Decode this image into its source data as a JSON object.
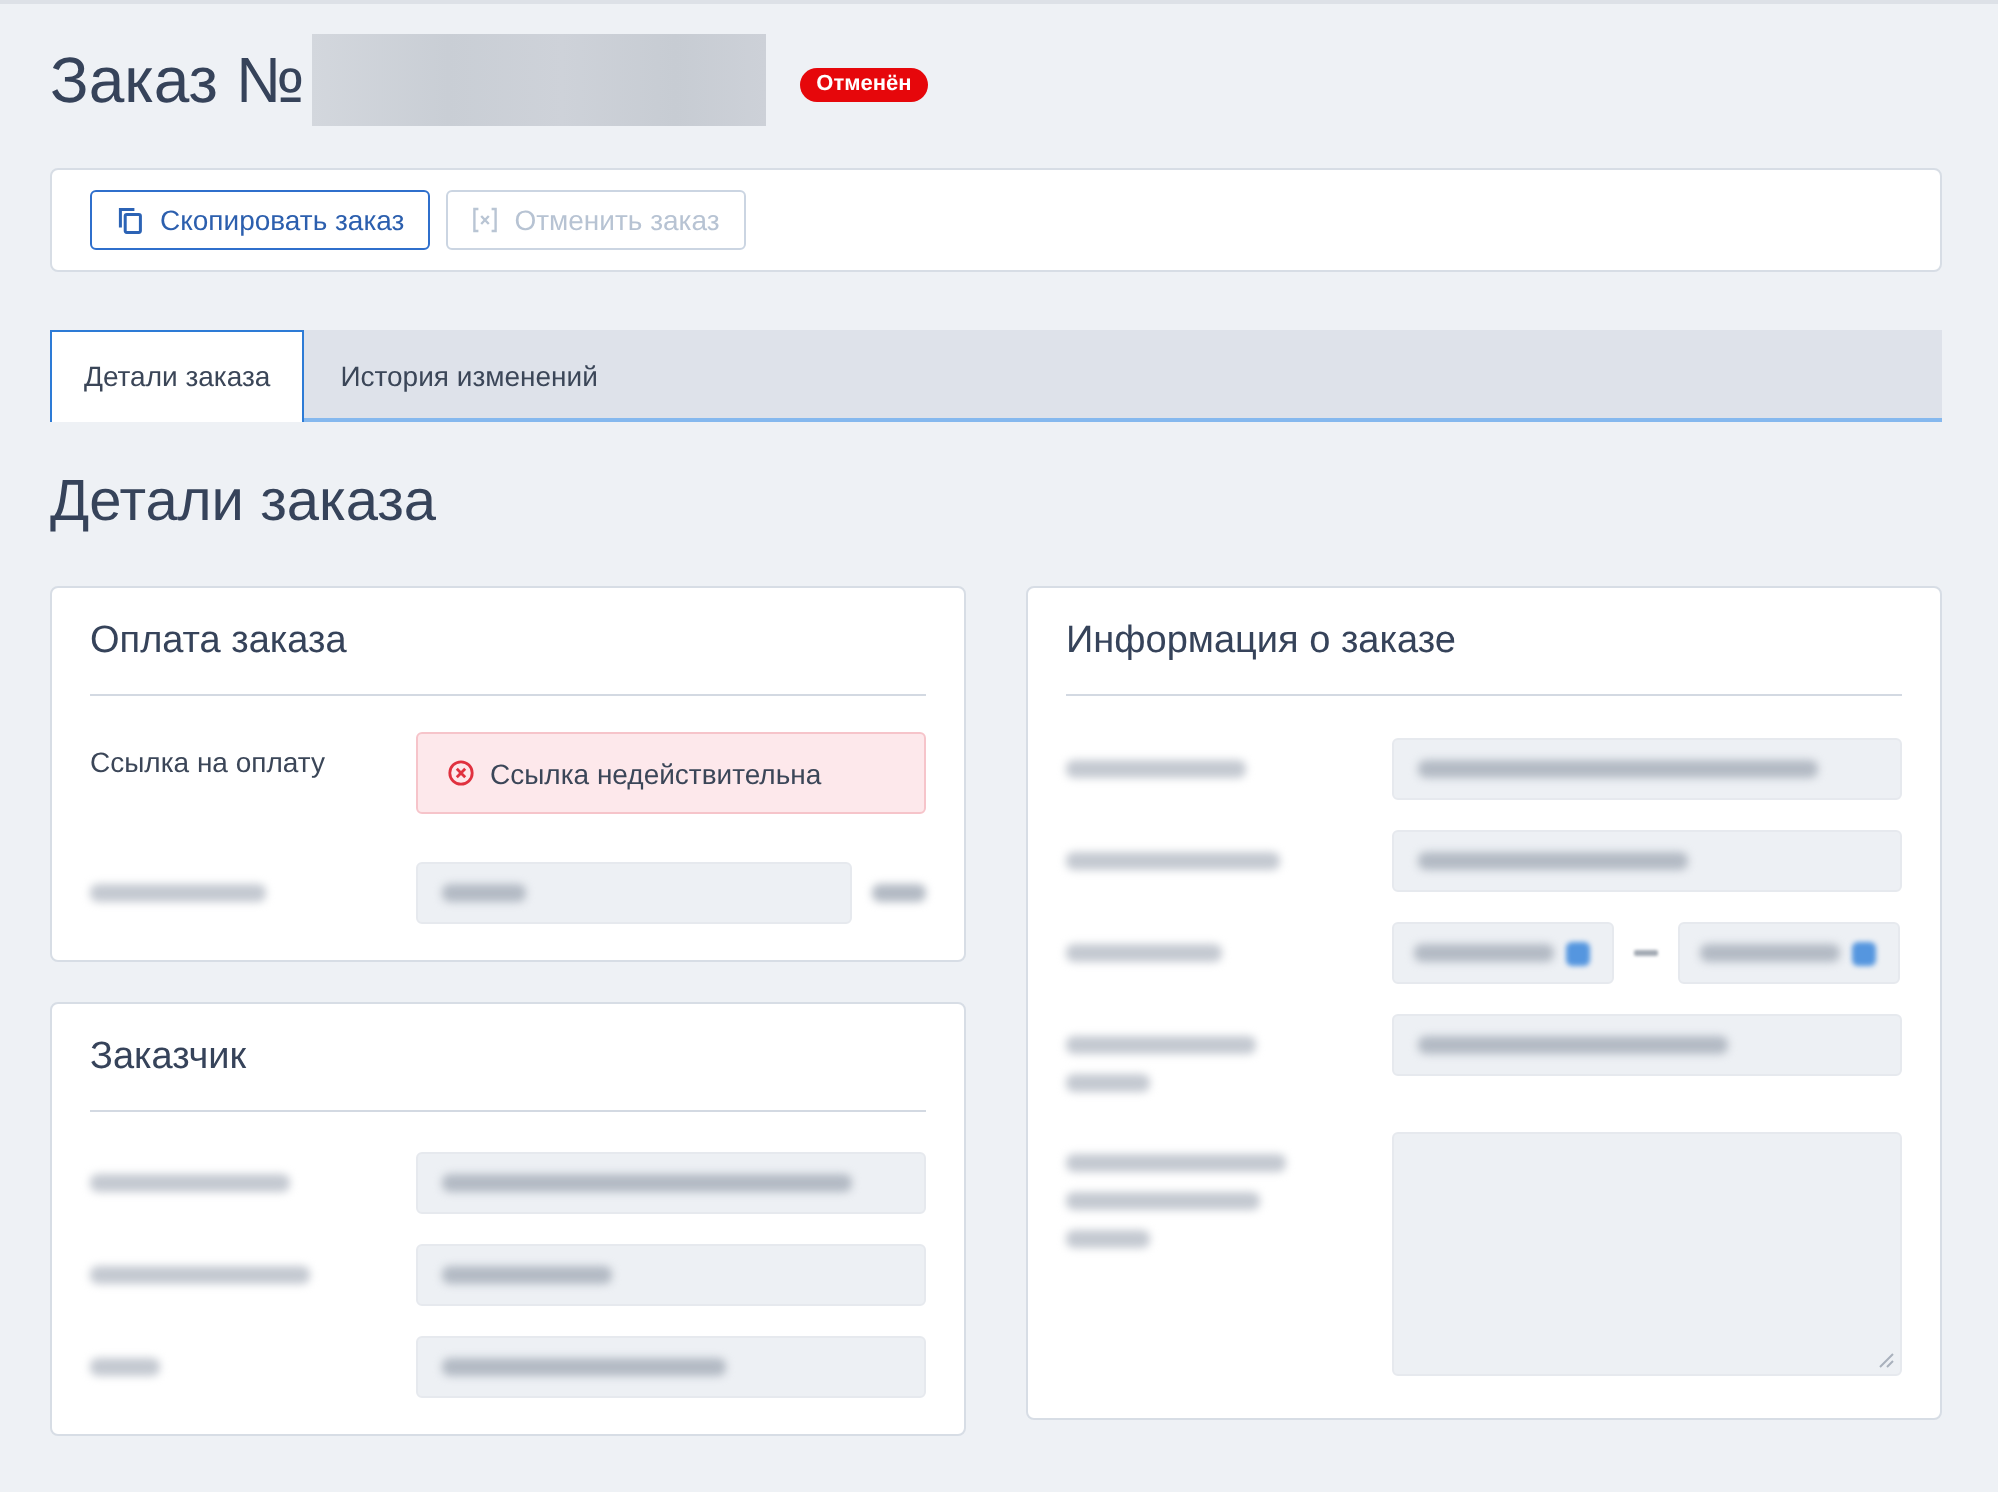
{
  "header": {
    "title": "Заказ №",
    "order_number_redacted": true,
    "status": "Отменён"
  },
  "actions": [
    {
      "label": "Скопировать заказ",
      "disabled": false
    },
    {
      "label": "Отменить заказ",
      "disabled": true
    }
  ],
  "tabs": [
    {
      "label": "Детали заказа",
      "selected": true
    },
    {
      "label": "История изменений",
      "selected": false
    }
  ],
  "section_title": "Детали заказа",
  "columns": [
    {
      "cards": [
        {
          "title": "Оплата заказа",
          "rows": [
            {
              "kind": "link_status",
              "label": "Ссылка на оплату",
              "status": "Ссылка недействительна",
              "valid": false
            },
            {
              "kind": "amount"
            }
          ]
        },
        {
          "title": "Заказчик",
          "rows": [
            {
              "kind": "field"
            },
            {
              "kind": "field"
            },
            {
              "kind": "field"
            }
          ]
        }
      ]
    },
    {
      "cards": [
        {
          "title": "Информация о заказе",
          "rows": [
            {
              "kind": "field"
            },
            {
              "kind": "field"
            },
            {
              "kind": "date_range"
            },
            {
              "kind": "datetime"
            },
            {
              "kind": "textarea"
            }
          ]
        }
      ]
    }
  ]
}
